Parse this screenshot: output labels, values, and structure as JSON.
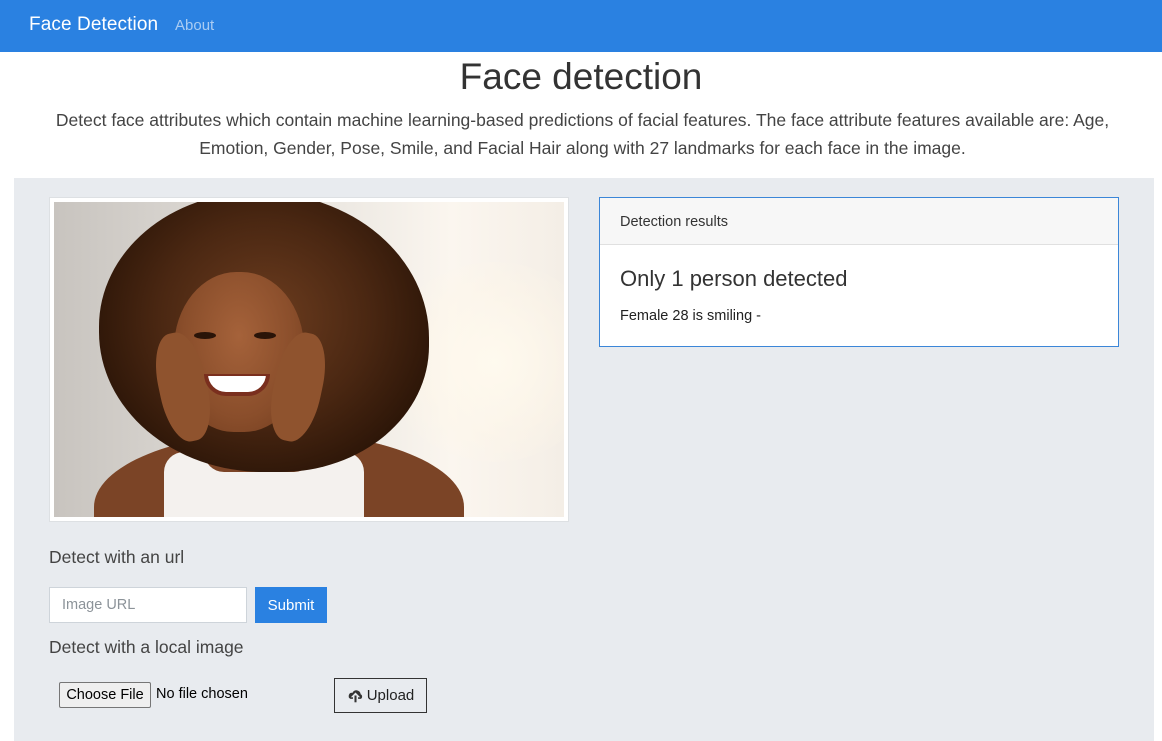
{
  "navbar": {
    "brand": "Face Detection",
    "links": [
      {
        "label": "About"
      }
    ]
  },
  "header": {
    "title": "Face detection",
    "description": "Detect face attributes which contain machine learning-based predictions of facial features. The face attribute features available are: Age, Emotion, Gender, Pose, Smile, and Facial Hair along with 27 landmarks for each face in the image."
  },
  "image": {
    "icon": "portrait-photo"
  },
  "results": {
    "header": "Detection results",
    "title": "Only 1 person detected",
    "detail": "Female 28 is smiling -"
  },
  "url_form": {
    "label": "Detect with an url",
    "placeholder": "Image URL",
    "value": "",
    "submit_label": "Submit"
  },
  "local_form": {
    "label": "Detect with a local image",
    "choose_label": "Choose File",
    "file_status": "No file chosen",
    "upload_label": "Upload",
    "upload_icon": "cloud-upload-icon"
  },
  "colors": {
    "primary": "#2a81e1",
    "panel_bg": "#e8ebef",
    "results_border": "#3b86d8"
  }
}
